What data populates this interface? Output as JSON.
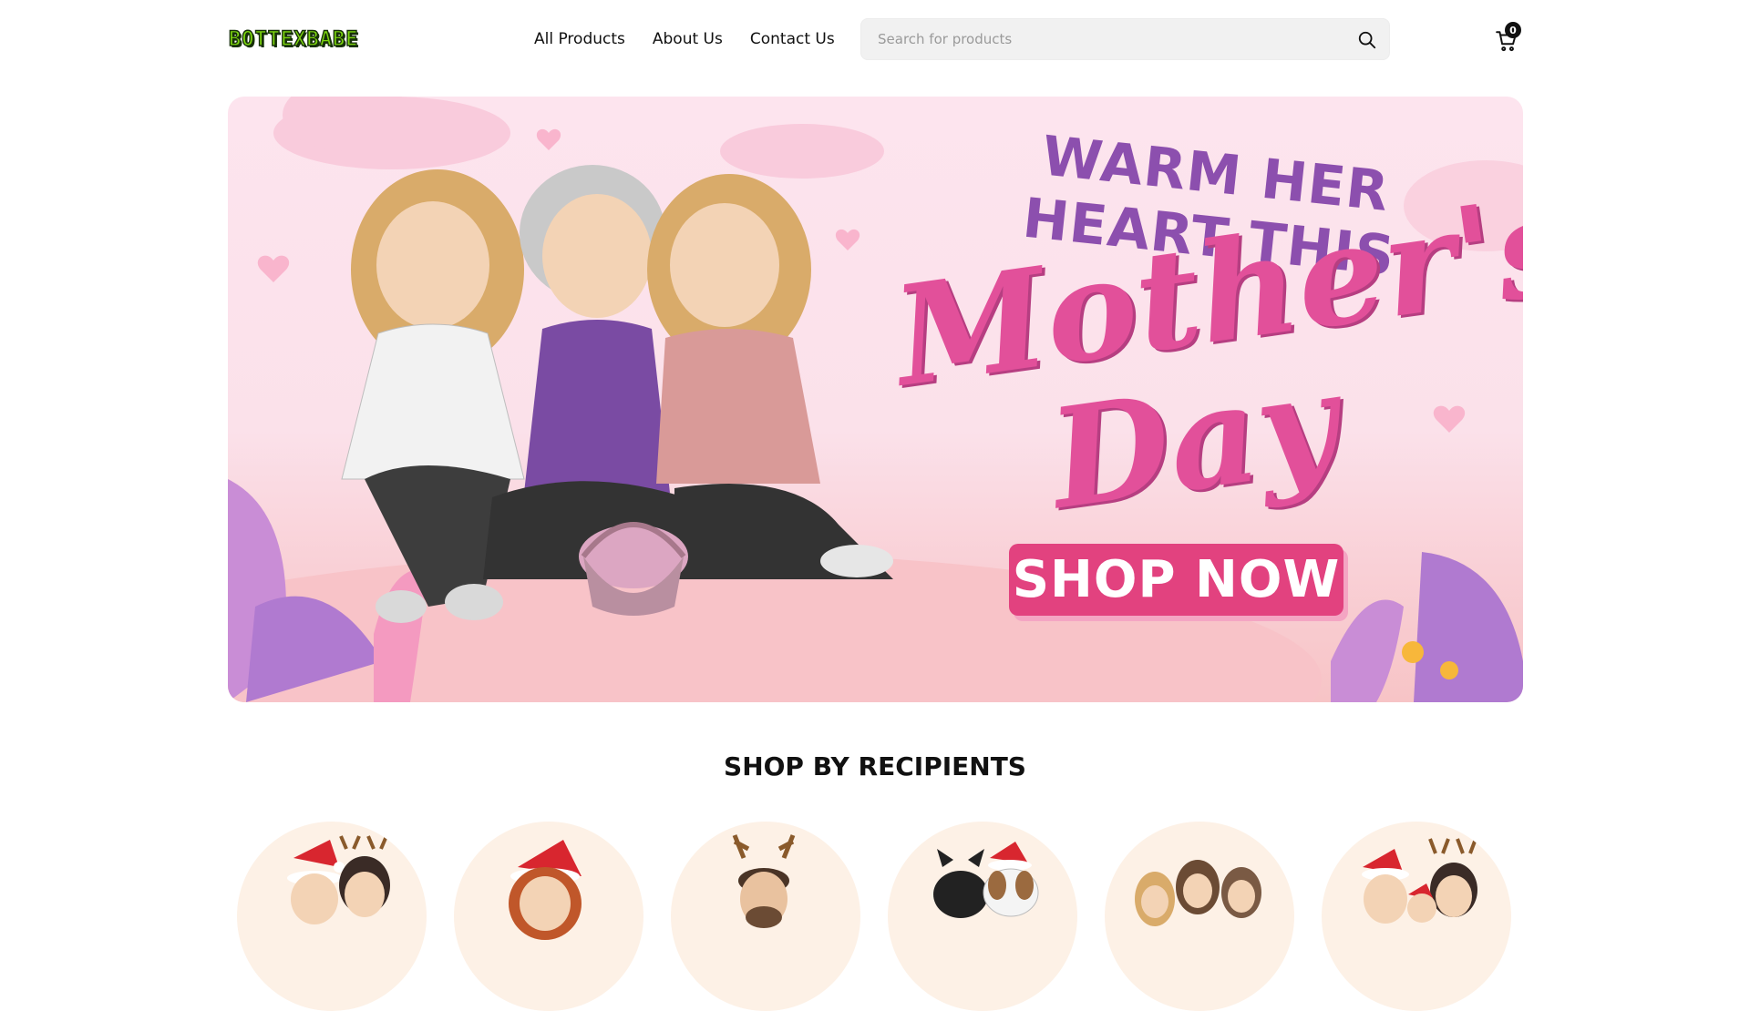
{
  "header": {
    "logo_text": "BOTTEXBABE",
    "nav": [
      {
        "label": "All Products"
      },
      {
        "label": "About Us"
      },
      {
        "label": "Contact Us"
      }
    ],
    "search": {
      "placeholder": "Search for products",
      "value": ""
    },
    "cart": {
      "count": "0"
    }
  },
  "banner": {
    "line1": "WARM HER HEART THIS",
    "line2": "Mother's",
    "line3": "Day",
    "cta": "SHOP NOW"
  },
  "section": {
    "title": "SHOP BY RECIPIENTS"
  },
  "recipients": [
    {
      "icon": "couple-santa-reindeer-icon"
    },
    {
      "icon": "woman-santa-hat-icon"
    },
    {
      "icon": "man-reindeer-antlers-icon"
    },
    {
      "icon": "pets-christmas-icon"
    },
    {
      "icon": "three-women-icon"
    },
    {
      "icon": "family-christmas-icon"
    }
  ],
  "colors": {
    "accent_pink": "#e2427f",
    "logo_green": "#7cd40f",
    "banner_bg": "#fde4ee",
    "title_purple": "#8c4fae"
  }
}
